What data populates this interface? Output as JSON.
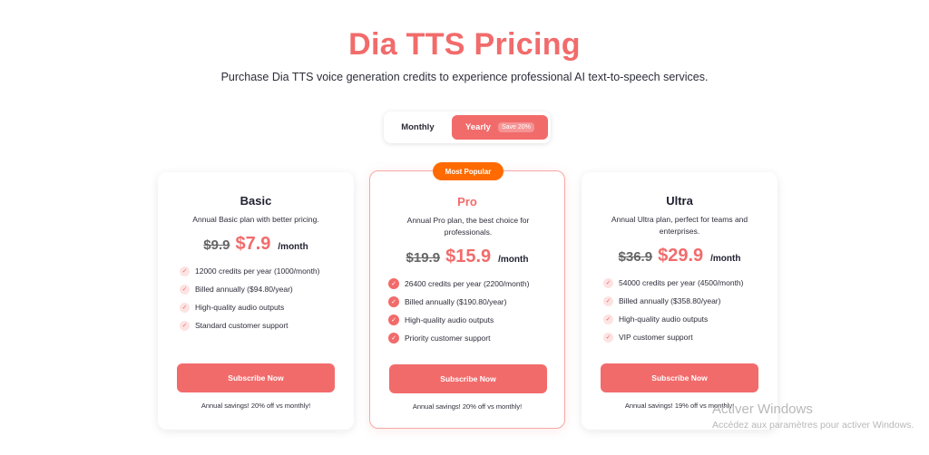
{
  "page": {
    "title": "Dia TTS Pricing",
    "subtitle": "Purchase Dia TTS voice generation credits to experience professional AI text-to-speech services."
  },
  "billing_toggle": {
    "monthly_label": "Monthly",
    "yearly_label": "Yearly",
    "yearly_badge": "Save 20%",
    "selected": "Yearly"
  },
  "plans": [
    {
      "name": "Basic",
      "description": "Annual Basic plan with better pricing.",
      "old_price": "$9.9",
      "price": "$7.9",
      "period": "/month",
      "features": [
        "12000 credits per year (1000/month)",
        "Billed annually ($94.80/year)",
        "High-quality audio outputs",
        "Standard customer support"
      ],
      "button_label": "Subscribe Now",
      "savings": "Annual savings! 20% off vs monthly!"
    },
    {
      "name": "Pro",
      "badge": "Most Popular",
      "description": "Annual Pro plan, the best choice for professionals.",
      "old_price": "$19.9",
      "price": "$15.9",
      "period": "/month",
      "features": [
        "26400 credits per year (2200/month)",
        "Billed annually ($190.80/year)",
        "High-quality audio outputs",
        "Priority customer support"
      ],
      "button_label": "Subscribe Now",
      "savings": "Annual savings! 20% off vs monthly!"
    },
    {
      "name": "Ultra",
      "description": "Annual Ultra plan, perfect for teams and enterprises.",
      "old_price": "$36.9",
      "price": "$29.9",
      "period": "/month",
      "features": [
        "54000 credits per year (4500/month)",
        "Billed annually ($358.80/year)",
        "High-quality audio outputs",
        "VIP customer support"
      ],
      "button_label": "Subscribe Now",
      "savings": "Annual savings! 19% off vs monthly!"
    }
  ],
  "os_watermark": {
    "title": "Activer Windows",
    "subtitle": "Accédez aux paramètres pour activer Windows."
  },
  "colors": {
    "accent": "#f26b6b",
    "popular_badge": "#ff6b00",
    "text_dark": "#1f2030"
  },
  "icons": {
    "feature_check": "check-circle-icon"
  }
}
